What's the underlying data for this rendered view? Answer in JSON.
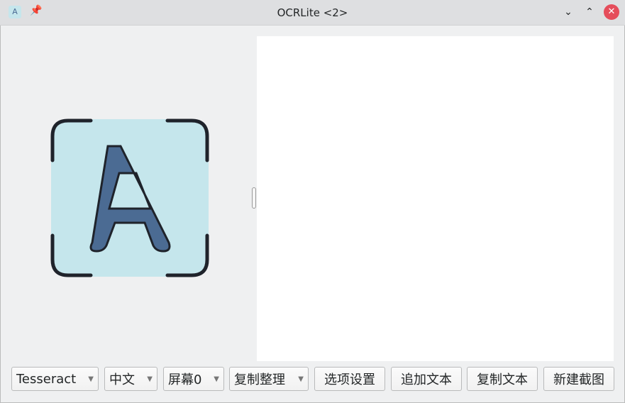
{
  "window": {
    "title": "OCRLite <2>",
    "app_icon_letter": "A"
  },
  "toolbar": {
    "engine": "Tesseract",
    "language": "中文",
    "screen": "屏幕0",
    "copy_mode": "复制整理",
    "options_label": "选项设置",
    "append_label": "追加文本",
    "copy_label": "复制文本",
    "new_capture_label": "新建截图"
  },
  "output_text": "",
  "colors": {
    "logo_bg": "#c5e6ec",
    "logo_letter": "#4b6b93",
    "close": "#e54d5b"
  }
}
